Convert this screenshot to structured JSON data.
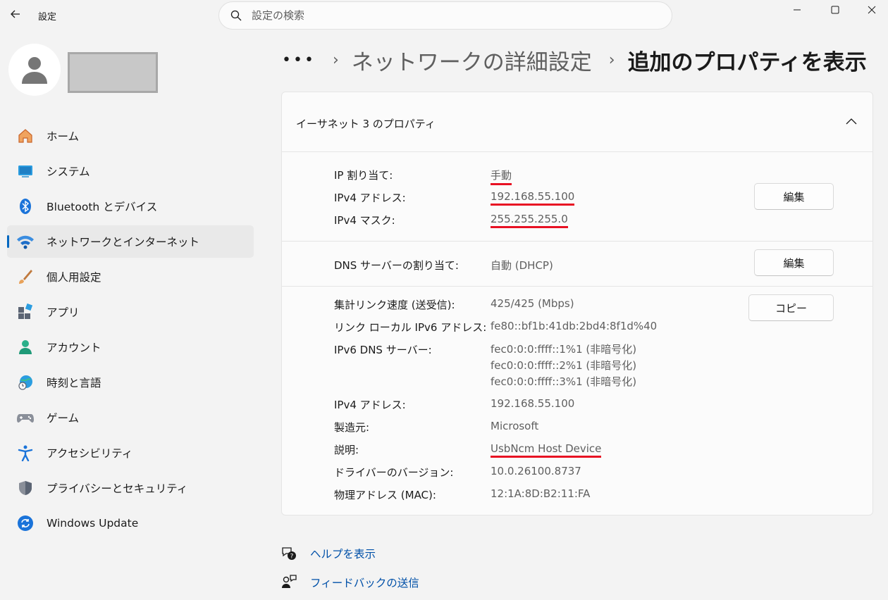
{
  "titlebar": {
    "app_title": "設定",
    "search_placeholder": "設定の検索"
  },
  "sidebar": {
    "items": [
      {
        "label": "ホーム",
        "icon": "home-icon"
      },
      {
        "label": "システム",
        "icon": "system-icon"
      },
      {
        "label": "Bluetooth とデバイス",
        "icon": "bluetooth-icon"
      },
      {
        "label": "ネットワークとインターネット",
        "icon": "wifi-icon",
        "active": true
      },
      {
        "label": "個人用設定",
        "icon": "brush-icon"
      },
      {
        "label": "アプリ",
        "icon": "apps-icon"
      },
      {
        "label": "アカウント",
        "icon": "account-icon"
      },
      {
        "label": "時刻と言語",
        "icon": "globe-clock-icon"
      },
      {
        "label": "ゲーム",
        "icon": "gamepad-icon"
      },
      {
        "label": "アクセシビリティ",
        "icon": "accessibility-icon"
      },
      {
        "label": "プライバシーとセキュリティ",
        "icon": "shield-icon"
      },
      {
        "label": "Windows Update",
        "icon": "update-icon"
      }
    ]
  },
  "breadcrumb": {
    "dots": "•••",
    "parent": "ネットワークの詳細設定",
    "current": "追加のプロパティを表示"
  },
  "card": {
    "title": "イーサネット 3 のプロパティ",
    "ip_section": {
      "assignment_label": "IP 割り当て:",
      "assignment_value": "手動",
      "ipv4_label": "IPv4 アドレス:",
      "ipv4_value": "192.168.55.100",
      "mask_label": "IPv4 マスク:",
      "mask_value": "255.255.255.0",
      "edit_label": "編集"
    },
    "dns_section": {
      "label": "DNS サーバーの割り当て:",
      "value": "自動 (DHCP)",
      "edit_label": "編集"
    },
    "info_section": {
      "copy_label": "コピー",
      "link_speed_label": "集計リンク速度 (送受信):",
      "link_speed_value": "425/425 (Mbps)",
      "link_local_label": "リンク ローカル IPv6 アドレス:",
      "link_local_value": "fe80::bf1b:41db:2bd4:8f1d%40",
      "ipv6_dns_label": "IPv6 DNS サーバー:",
      "ipv6_dns_values": [
        "fec0:0:0:ffff::1%1 (非暗号化)",
        "fec0:0:0:ffff::2%1 (非暗号化)",
        "fec0:0:0:ffff::3%1 (非暗号化)"
      ],
      "ipv4_label": "IPv4 アドレス:",
      "ipv4_value": "192.168.55.100",
      "manufacturer_label": "製造元:",
      "manufacturer_value": "Microsoft",
      "description_label": "説明:",
      "description_value": "UsbNcm Host Device",
      "driver_label": "ドライバーのバージョン:",
      "driver_value": "10.0.26100.8737",
      "mac_label": "物理アドレス (MAC):",
      "mac_value": "12:1A:8D:B2:11:FA"
    }
  },
  "footer": {
    "help": "ヘルプを表示",
    "feedback": "フィードバックの送信"
  },
  "colors": {
    "accent": "#0067c0",
    "link": "#0050a8",
    "annotation": "#e81123"
  }
}
